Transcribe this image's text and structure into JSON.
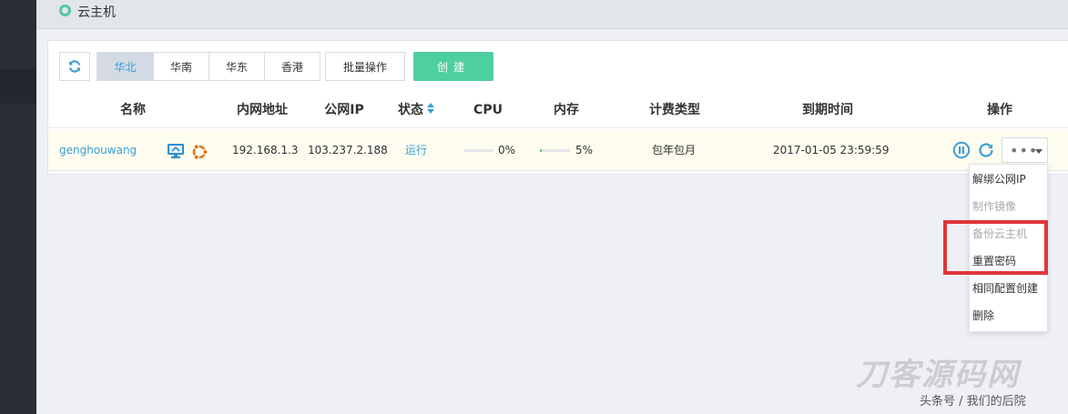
{
  "header": {
    "title": "云主机"
  },
  "toolbar": {
    "regions": [
      "华北",
      "华南",
      "华东",
      "香港"
    ],
    "active_region": "华北",
    "batch_label": "批量操作",
    "create_label": "创建"
  },
  "table": {
    "columns": {
      "name": "名称",
      "private_ip": "内网地址",
      "public_ip": "公网IP",
      "status": "状态",
      "cpu": "CPU",
      "memory": "内存",
      "billing": "计费类型",
      "expiry": "到期时间",
      "actions": "操作"
    },
    "rows": [
      {
        "name": "genghouwang",
        "private_ip": "192.168.1.3",
        "public_ip": "103.237.2.188",
        "status": "运行",
        "cpu": "0%",
        "cpu_fraction": 0.0,
        "memory": "5%",
        "memory_fraction": 0.05,
        "billing": "包年包月",
        "expiry": "2017-01-05 23:59:59"
      }
    ]
  },
  "dropdown": {
    "items": [
      {
        "label": "解绑公网IP",
        "disabled": false
      },
      {
        "label": "制作镜像",
        "disabled": true
      },
      {
        "label": "备份云主机",
        "disabled": true
      },
      {
        "label": "重置密码",
        "disabled": false
      },
      {
        "label": "相同配置创建",
        "disabled": false
      },
      {
        "label": "删除",
        "disabled": false
      }
    ]
  },
  "watermark": {
    "logo_text": "刀客源码网",
    "caption": "头条号 / 我们的后院"
  },
  "colors": {
    "accent": "#3a9ed6",
    "create_button": "#4ecf9f",
    "highlight": "#e0353a",
    "sidebar": "#2b2e36",
    "row_highlight": "#fdfcee"
  }
}
